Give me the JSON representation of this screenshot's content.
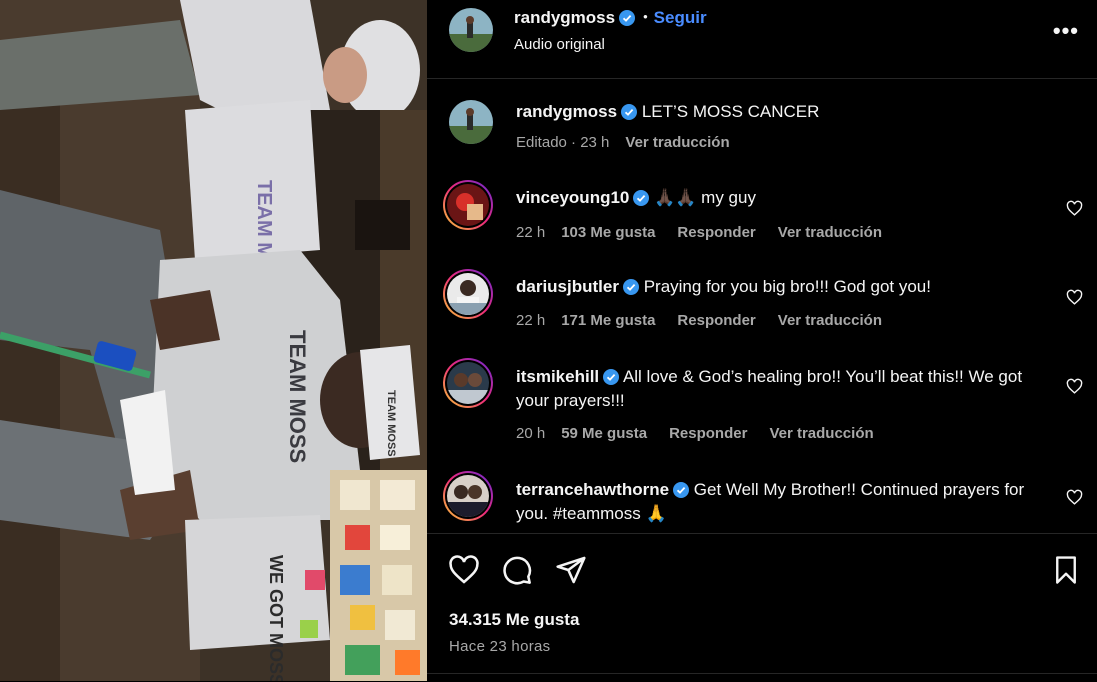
{
  "post": {
    "author": "randygmoss",
    "follow_label": "Seguir",
    "dot": "•",
    "audio": "Audio original",
    "more": "•••",
    "caption": "LET’S MOSS CANCER",
    "edited": "Editado · 23 h",
    "translate": "Ver traducción",
    "likes": "34.315 Me gusta",
    "posted": "Hace 23 horas"
  },
  "comments": [
    {
      "user": "vinceyoung10",
      "text": "🙏🏿🙏🏿 my guy",
      "time": "22 h",
      "likes": "103 Me gusta",
      "reply": "Responder",
      "translate": "Ver traducción"
    },
    {
      "user": "dariusjbutler",
      "text": "Praying for you big bro!!! God got you!",
      "time": "22 h",
      "likes": "171 Me gusta",
      "reply": "Responder",
      "translate": "Ver traducción"
    },
    {
      "user": "itsmikehill",
      "text": "All love & God’s healing bro!! You’ll beat this!! We got your prayers!!!",
      "time": "20 h",
      "likes": "59 Me gusta",
      "reply": "Responder",
      "translate": "Ver traducción"
    },
    {
      "user": "terrancehawthorne",
      "text": "Get Well My Brother!! Continued prayers for you. #teammoss 🙏",
      "time": "",
      "likes": "",
      "reply": "",
      "translate": ""
    }
  ],
  "media": {
    "sign_top": "TEAM MOSS",
    "sign_hoodie": "TEAM MOSS",
    "beanie": "TEAM MOSS",
    "sign_bottom": "WE GOT MOSS"
  },
  "colors": {
    "accent": "#4a8cff",
    "verified": "#3897f0",
    "muted": "#a8a8a8"
  },
  "icons": [
    "verified-badge-icon",
    "more-options-icon",
    "heart-icon",
    "comment-icon",
    "share-icon",
    "bookmark-icon"
  ]
}
